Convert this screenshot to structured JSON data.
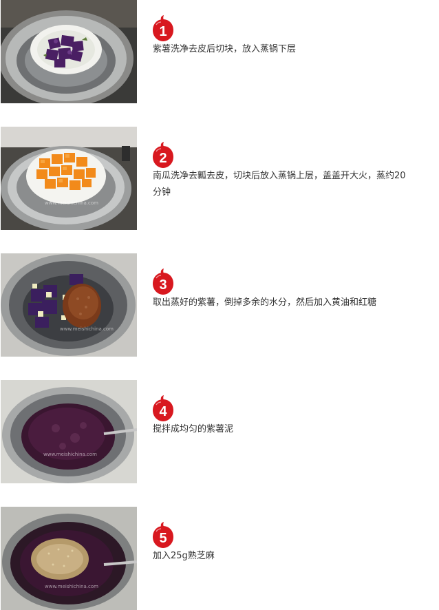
{
  "steps": [
    {
      "number": "1",
      "text": "紫薯洗净去皮后切块，放入蒸锅下层",
      "watermark": ""
    },
    {
      "number": "2",
      "text": "南瓜洗净去瓤去皮，切块后放入蒸锅上层，盖盖开大火，蒸约20分钟",
      "watermark": "www.meishichina.com"
    },
    {
      "number": "3",
      "text": "取出蒸好的紫薯，倒掉多余的水分，然后加入黄油和红糖",
      "watermark": "www.meishichina.com"
    },
    {
      "number": "4",
      "text": "搅拌成均匀的紫薯泥",
      "watermark": "www.meishichina.com"
    },
    {
      "number": "5",
      "text": "加入25g熟芝麻",
      "watermark": "www.meishichina.com"
    }
  ],
  "colors": {
    "badge_red": "#d8181f",
    "text": "#333333"
  },
  "icons": [
    "number-badge-icon"
  ]
}
